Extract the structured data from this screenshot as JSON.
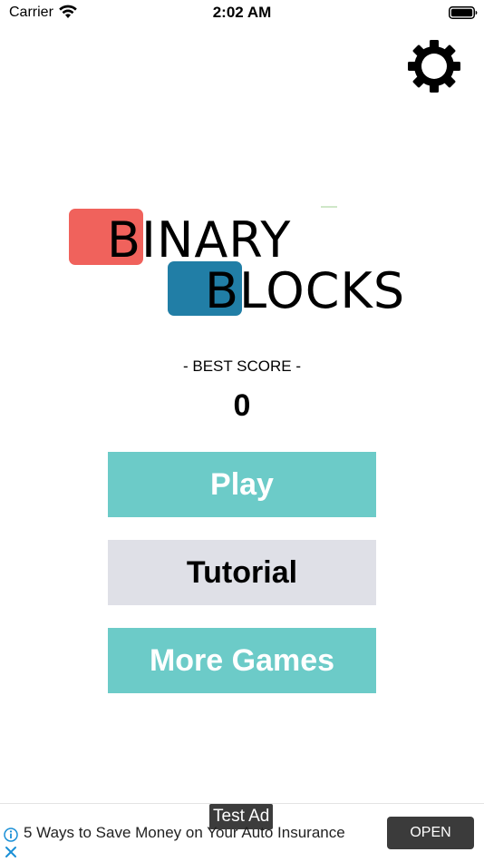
{
  "status_bar": {
    "carrier": "Carrier",
    "time": "2:02 AM",
    "wifi_icon": "wifi-icon",
    "battery_icon": "battery-full-icon"
  },
  "header": {
    "settings_icon": "gear-icon"
  },
  "logo": {
    "line1": "BINARY",
    "line2": "BLOCKS",
    "colors": {
      "red_block": "#F0625C",
      "blue_block": "#217EA6"
    }
  },
  "best_score": {
    "label": "- BEST SCORE -",
    "value": "0"
  },
  "menu": {
    "play_label": "Play",
    "tutorial_label": "Tutorial",
    "more_games_label": "More Games",
    "colors": {
      "primary_bg": "#6CCBC8",
      "primary_text": "#FFFFFF",
      "secondary_bg": "#DFE0E7",
      "secondary_text": "#000000"
    }
  },
  "ad": {
    "tag": "Test Ad",
    "text": "5 Ways to Save Money on Your Auto Insurance",
    "cta": "OPEN",
    "info_icon": "info-icon",
    "close_icon": "close-icon"
  }
}
